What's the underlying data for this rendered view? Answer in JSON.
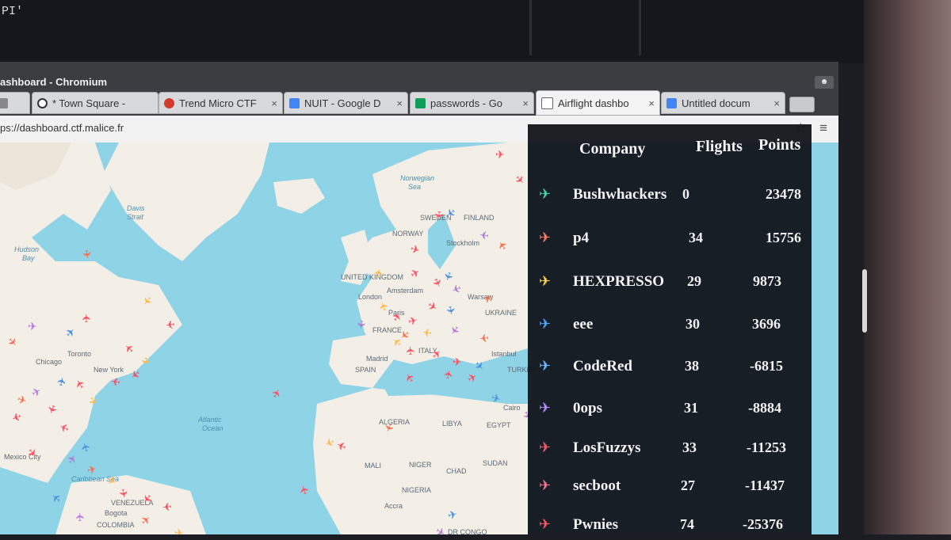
{
  "terminal": {
    "text": "PI'"
  },
  "window": {
    "title": "ashboard - Chromium"
  },
  "tabs": [
    {
      "label": "",
      "favicon": "#888888"
    },
    {
      "label": "* Town Square -",
      "favicon": "#333333"
    },
    {
      "label": "Trend Micro CTF",
      "favicon": "#d33a2c"
    },
    {
      "label": "NUIT - Google D",
      "favicon": "#4285f4"
    },
    {
      "label": "passwords - Go",
      "favicon": "#0f9d58"
    },
    {
      "label": "Airflight dashbo",
      "favicon": "#ffffff"
    },
    {
      "label": "Untitled docum",
      "favicon": "#4285f4"
    }
  ],
  "toolbar": {
    "url": "ps://dashboard.ctf.malice.fr"
  },
  "map": {
    "labels": [
      {
        "text": "Norwegian",
        "kind": "water"
      },
      {
        "text": "Sea",
        "kind": "water"
      },
      {
        "text": "Davis",
        "kind": "water"
      },
      {
        "text": "Strait",
        "kind": "water"
      },
      {
        "text": "Hudson",
        "kind": "water"
      },
      {
        "text": "Bay",
        "kind": "water"
      },
      {
        "text": "Atlantic",
        "kind": "water"
      },
      {
        "text": "Ocean",
        "kind": "water"
      },
      {
        "text": "SWEDEN",
        "kind": "land"
      },
      {
        "text": "FINLAND",
        "kind": "land"
      },
      {
        "text": "NORWAY",
        "kind": "land"
      },
      {
        "text": "Stockholm",
        "kind": "land"
      },
      {
        "text": "UNITED KINGDOM",
        "kind": "land"
      },
      {
        "text": "London",
        "kind": "land"
      },
      {
        "text": "Amsterdam",
        "kind": "land"
      },
      {
        "text": "Paris",
        "kind": "land"
      },
      {
        "text": "FRANCE",
        "kind": "land"
      },
      {
        "text": "Warsaw",
        "kind": "land"
      },
      {
        "text": "UKRAINE",
        "kind": "land"
      },
      {
        "text": "Madrid",
        "kind": "land"
      },
      {
        "text": "SPAIN",
        "kind": "land"
      },
      {
        "text": "ITALY",
        "kind": "land"
      },
      {
        "text": "Istanbul",
        "kind": "land"
      },
      {
        "text": "TURKEY",
        "kind": "land"
      },
      {
        "text": "Cairo",
        "kind": "land"
      },
      {
        "text": "EGYPT",
        "kind": "land"
      },
      {
        "text": "ALGERIA",
        "kind": "land"
      },
      {
        "text": "LIBYA",
        "kind": "land"
      },
      {
        "text": "MALI",
        "kind": "land"
      },
      {
        "text": "NIGER",
        "kind": "land"
      },
      {
        "text": "CHAD",
        "kind": "land"
      },
      {
        "text": "SUDAN",
        "kind": "land"
      },
      {
        "text": "NIGERIA",
        "kind": "land"
      },
      {
        "text": "Accra",
        "kind": "land"
      },
      {
        "text": "DR CONGO",
        "kind": "land"
      },
      {
        "text": "Toronto",
        "kind": "land"
      },
      {
        "text": "Chicago",
        "kind": "land"
      },
      {
        "text": "New York",
        "kind": "land"
      },
      {
        "text": "Mexico City",
        "kind": "land"
      },
      {
        "text": "Caribbean Sea",
        "kind": "water"
      },
      {
        "text": "Bogota",
        "kind": "land"
      },
      {
        "text": "COLOMBIA",
        "kind": "land"
      },
      {
        "text": "VENEZUELA",
        "kind": "land"
      }
    ]
  },
  "scoreboard": {
    "headers": {
      "company": "Company",
      "flights": "Flights",
      "points": "Points"
    },
    "rows": [
      {
        "company": "Bushwhackers",
        "flights": "0",
        "points": "23478",
        "color": "#3fd6a0"
      },
      {
        "company": "p4",
        "flights": "34",
        "points": "15756",
        "color": "#ff7a5a"
      },
      {
        "company": "HEXPRESSO",
        "flights": "29",
        "points": "9873",
        "color": "#ffd24a"
      },
      {
        "company": "eee",
        "flights": "30",
        "points": "3696",
        "color": "#4aa3ff"
      },
      {
        "company": "CodeRed",
        "flights": "38",
        "points": "-6815",
        "color": "#6ab8ff"
      },
      {
        "company": "0ops",
        "flights": "31",
        "points": "-8884",
        "color": "#b48cff"
      },
      {
        "company": "LosFuzzys",
        "flights": "33",
        "points": "-11253",
        "color": "#ff5a6a"
      },
      {
        "company": "secboot",
        "flights": "27",
        "points": "-11437",
        "color": "#ff6f8f"
      },
      {
        "company": "Pwnies",
        "flights": "74",
        "points": "-25376",
        "color": "#ff5560"
      }
    ]
  }
}
